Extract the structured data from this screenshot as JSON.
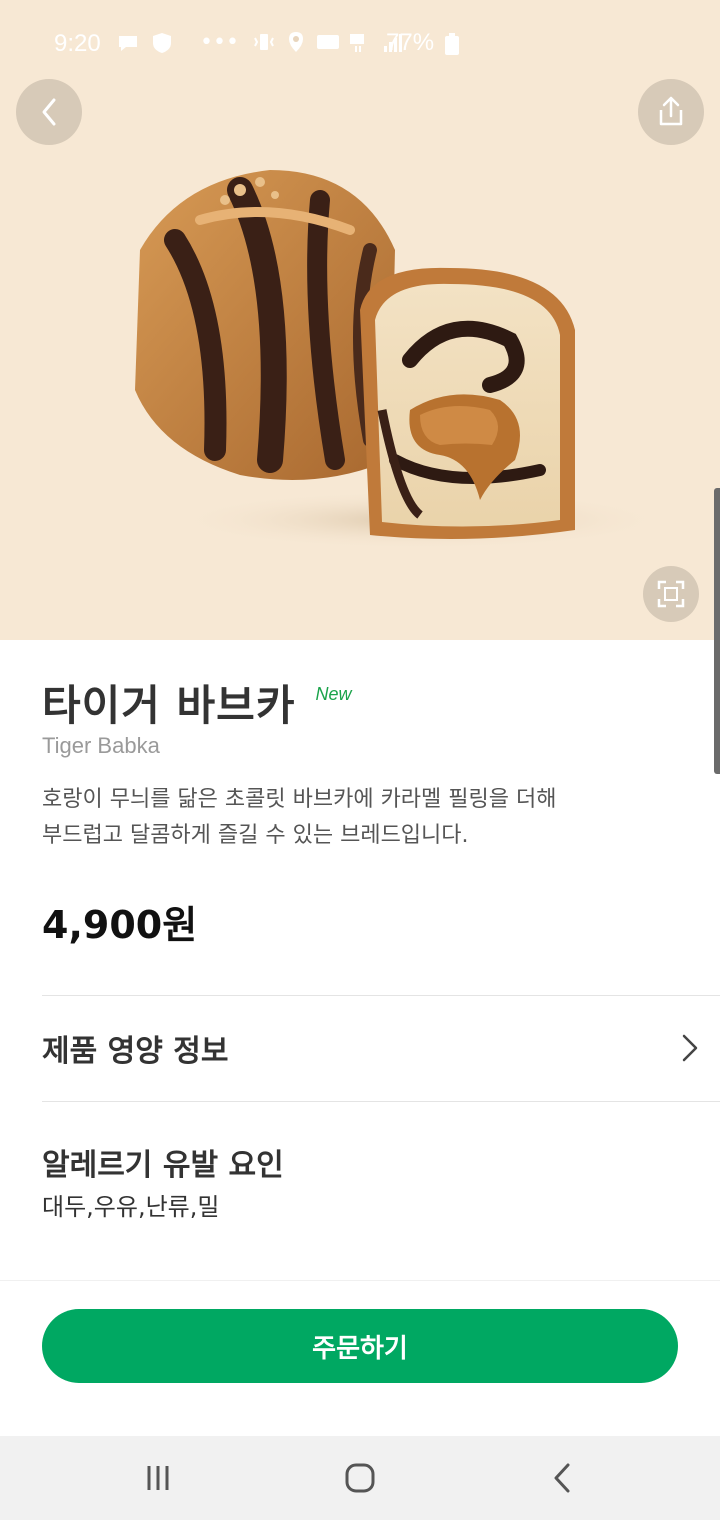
{
  "status_bar": {
    "time": "9:20",
    "battery": "77%"
  },
  "hero": {
    "background": "#f7e8d4"
  },
  "product": {
    "name": "타이거 바브카",
    "badge": "New",
    "english_name": "Tiger Babka",
    "description_line1": "호랑이 무늬를 닮은 초콜릿 바브카에 카라멜 필링을 더해",
    "description_line2": "부드럽고 달콤하게 즐길 수 있는 브레드입니다.",
    "price": "4,900원"
  },
  "nutrition": {
    "label": "제품 영양 정보"
  },
  "allergy": {
    "title": "알레르기 유발 요인",
    "items": "대두,우유,난류,밀"
  },
  "order": {
    "label": "주문하기"
  },
  "colors": {
    "accent": "#00a862",
    "new_badge": "#1aa34a"
  }
}
